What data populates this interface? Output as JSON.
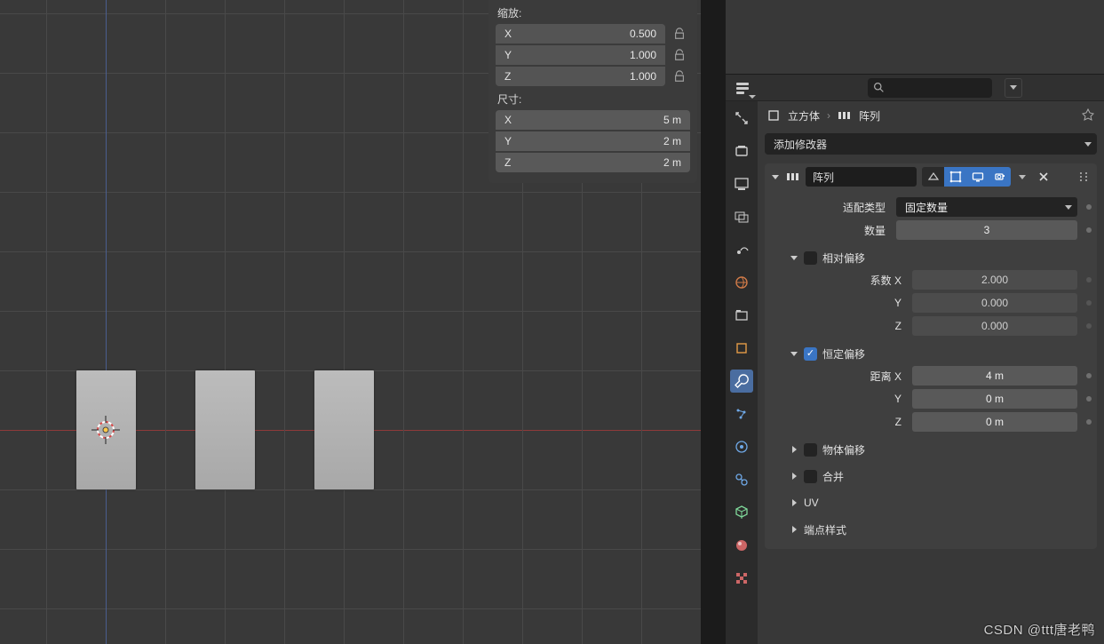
{
  "npanel": {
    "scale_label": "缩放:",
    "scale": {
      "x_label": "X",
      "x_value": "0.500",
      "y_label": "Y",
      "y_value": "1.000",
      "z_label": "Z",
      "z_value": "1.000"
    },
    "dim_label": "尺寸:",
    "dim": {
      "x_label": "X",
      "x_value": "5 m",
      "y_label": "Y",
      "y_value": "2 m",
      "z_label": "Z",
      "z_value": "2 m"
    }
  },
  "props_header": {
    "search_placeholder": ""
  },
  "breadcrumb": {
    "object": "立方体",
    "modifier": "阵列"
  },
  "add_modifier_label": "添加修改器",
  "modifier": {
    "name": "阵列",
    "fit_type_label": "适配类型",
    "fit_type_value": "固定数量",
    "count_label": "数量",
    "count_value": "3",
    "relative": {
      "title": "相对偏移",
      "factor_x_label": "系数 X",
      "factor_x": "2.000",
      "factor_y_label": "Y",
      "factor_y": "0.000",
      "factor_z_label": "Z",
      "factor_z": "0.000"
    },
    "constant": {
      "title": "恒定偏移",
      "dist_x_label": "距离 X",
      "dist_x": "4 m",
      "dist_y_label": "Y",
      "dist_y": "0 m",
      "dist_z_label": "Z",
      "dist_z": "0 m"
    },
    "object_offset_label": "物体偏移",
    "merge_label": "合并",
    "uv_label": "UV",
    "caps_label": "端点样式"
  },
  "watermark": "CSDN @ttt唐老鸭"
}
